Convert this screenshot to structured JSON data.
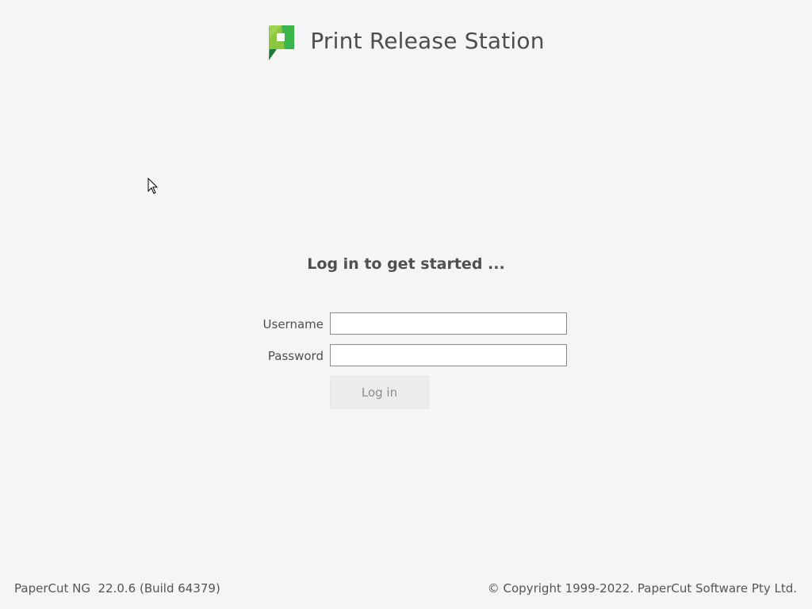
{
  "app": {
    "title": "Print Release Station",
    "logo_icon": "papercut-logo-icon",
    "brand_colors": {
      "green_light": "#8cc63f",
      "green_dark": "#39b54a",
      "green_shadow": "#1b7a3a"
    }
  },
  "login": {
    "prompt": "Log in to get started ...",
    "username_label": "Username",
    "username_value": "",
    "password_label": "Password",
    "password_value": "",
    "submit_label": "Log in"
  },
  "footer": {
    "version": "PaperCut NG  22.0.6 (Build 64379)",
    "copyright": "© Copyright 1999-2022. PaperCut Software Pty Ltd."
  },
  "cursor": {
    "icon": "mouse-pointer-icon"
  }
}
